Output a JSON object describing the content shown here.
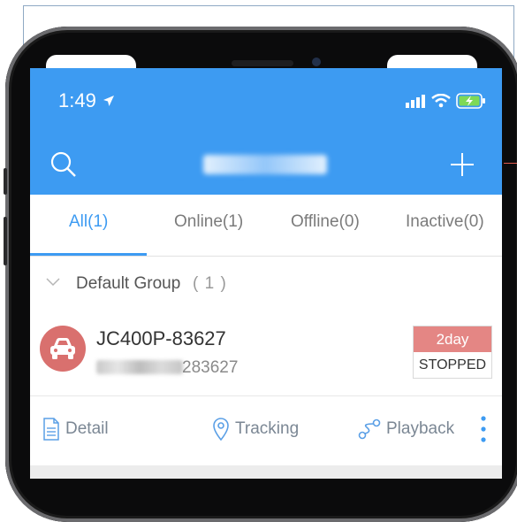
{
  "status_bar": {
    "time": "1:49"
  },
  "header": {
    "title_hidden": ""
  },
  "tabs": [
    {
      "label": "All(1)"
    },
    {
      "label": "Online(1)"
    },
    {
      "label": "Offline(0)"
    },
    {
      "label": "Inactive(0)"
    }
  ],
  "group": {
    "name": "Default Group",
    "count": "( 1 )"
  },
  "device": {
    "name": "JC400P-83627",
    "imei_suffix": "283627",
    "duration_badge": "2day",
    "status": "STOPPED"
  },
  "actions": {
    "detail": "Detail",
    "tracking": "Tracking",
    "playback": "Playback"
  },
  "colors": {
    "primary": "#3d9bf2",
    "badge": "#e48684",
    "car_circle": "#d9706e"
  },
  "icons": [
    "location-arrow-icon",
    "signal-icon",
    "wifi-icon",
    "battery-charging-icon",
    "search-icon",
    "add-icon",
    "chevron-down-icon",
    "car-icon",
    "document-icon",
    "map-pin-icon",
    "route-icon",
    "more-vertical-icon"
  ]
}
